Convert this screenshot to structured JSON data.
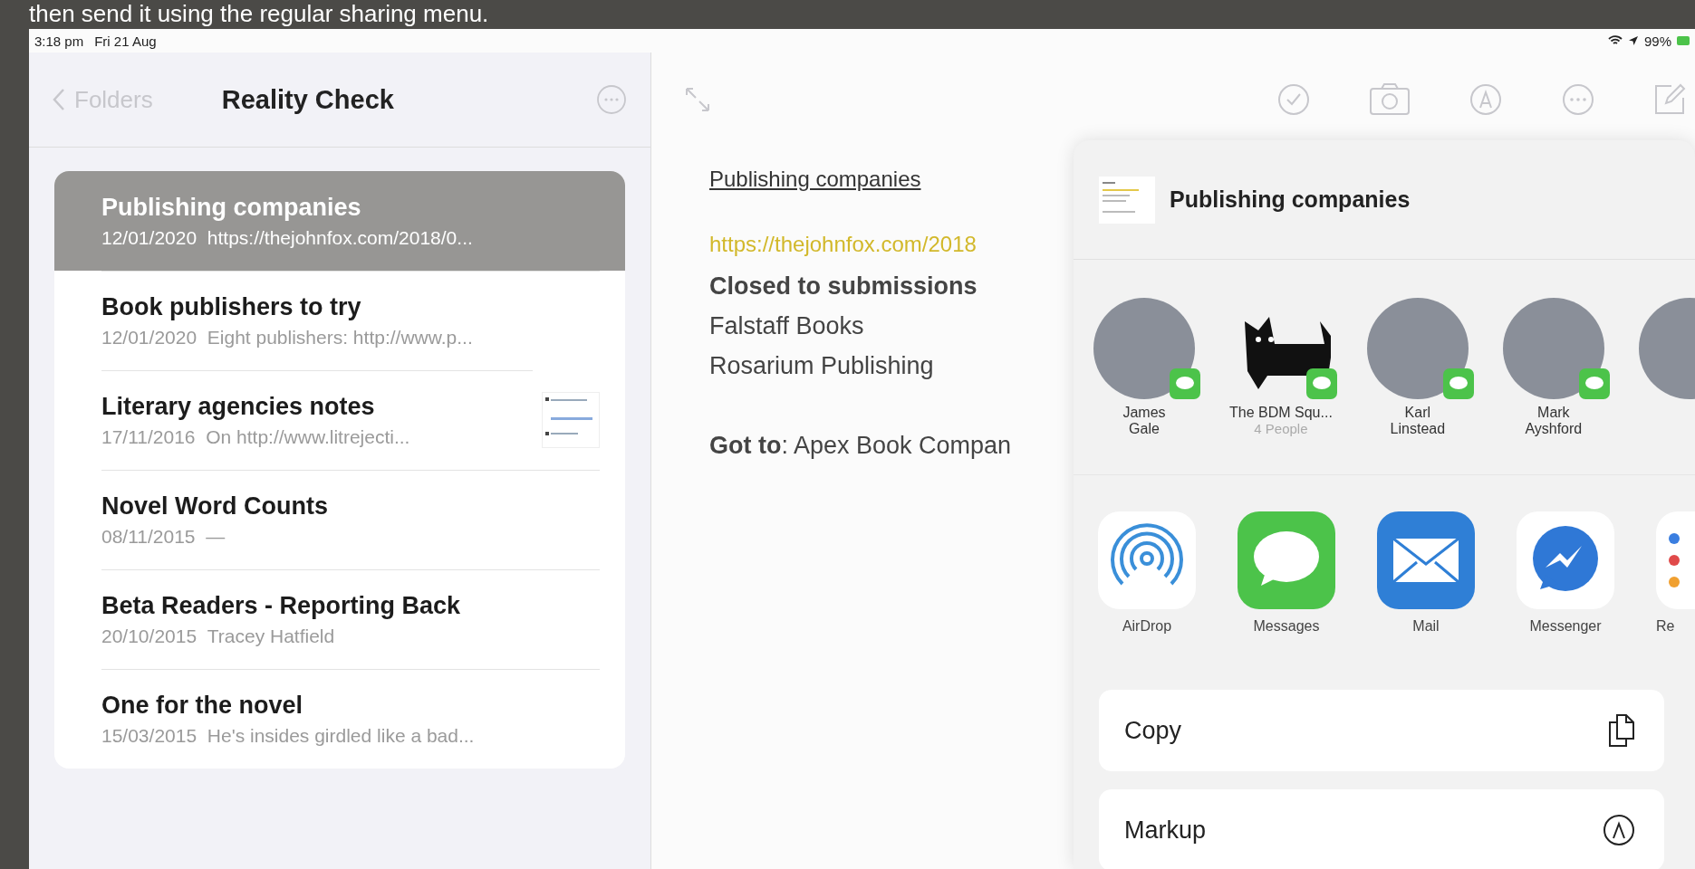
{
  "caption": "then send it using the regular sharing menu.",
  "status_bar": {
    "time": "3:18 pm",
    "date": "Fri 21 Aug",
    "battery": "99%"
  },
  "sidebar": {
    "back": "Folders",
    "title": "Reality Check",
    "notes": [
      {
        "title": "Publishing companies",
        "date": "12/01/2020",
        "preview": "https://thejohnfox.com/2018/0...",
        "selected": true,
        "thumbnail": false
      },
      {
        "title": "Book publishers to try",
        "date": "12/01/2020",
        "preview": "Eight publishers: http://www.p...",
        "selected": false,
        "thumbnail": false
      },
      {
        "title": "Literary agencies notes",
        "date": "17/11/2016",
        "preview": "On http://www.litrejecti...",
        "selected": false,
        "thumbnail": true
      },
      {
        "title": "Novel Word Counts",
        "date": "08/11/2015",
        "preview": "—",
        "selected": false,
        "thumbnail": false
      },
      {
        "title": "Beta Readers - Reporting Back",
        "date": "20/10/2015",
        "preview": "Tracey Hatfield",
        "selected": false,
        "thumbnail": false
      },
      {
        "title": "One for the novel",
        "date": "15/03/2015",
        "preview": "He's insides girdled like a bad...",
        "selected": false,
        "thumbnail": false
      }
    ]
  },
  "note": {
    "title": "Publishing companies",
    "link": "https://thejohnfox.com/2018",
    "lines": [
      {
        "text": "Closed to submissions",
        "kind": "bold"
      },
      {
        "text": "Falstaff Books",
        "kind": "plain"
      },
      {
        "text": "Rosarium Publishing",
        "kind": "plain"
      },
      {
        "text": "**Got to**: Apex Book Compan",
        "kind": "spaced"
      }
    ]
  },
  "share": {
    "title": "Publishing companies",
    "contacts": [
      {
        "name": "James Gale",
        "kind": "photo"
      },
      {
        "name": "The BDM Squ...",
        "subtitle": "4 People",
        "kind": "group"
      },
      {
        "name": "Karl Linstead",
        "kind": "photo"
      },
      {
        "name": "Mark Ayshford",
        "kind": "photo"
      }
    ],
    "apps": [
      {
        "label": "AirDrop",
        "kind": "airdrop"
      },
      {
        "label": "Messages",
        "kind": "messages"
      },
      {
        "label": "Mail",
        "kind": "mail"
      },
      {
        "label": "Messenger",
        "kind": "messenger"
      },
      {
        "label": "Re",
        "kind": "reminders"
      }
    ],
    "actions": [
      {
        "label": "Copy",
        "kind": "copy"
      },
      {
        "label": "Markup",
        "kind": "markup"
      }
    ]
  }
}
